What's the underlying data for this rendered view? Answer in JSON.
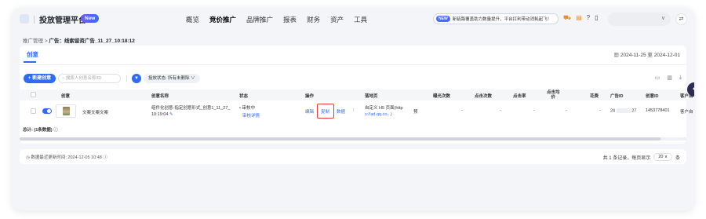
{
  "header": {
    "title": "投放管理平台",
    "new_badge": "New",
    "nav": [
      "概览",
      "竞价推广",
      "品牌推广",
      "报表",
      "财务",
      "资产",
      "工具"
    ],
    "active_nav_index": 1,
    "promo_tag": "NEW",
    "promo_text": "新链路覆盖助力数量提升，平台扛利带动消耗起飞！"
  },
  "breadcrumb": {
    "parent": "推广管理",
    "separator": ">",
    "current": "广告：线索留资广告_11_27_10:18:12"
  },
  "tab": {
    "label": "创意"
  },
  "date_range": "2024-11-25 至 2024-12-01",
  "toolbar": {
    "new_button": "+ 新建创意",
    "search_placeholder": "搜索人创意名称/ID",
    "filter_label": "投放状态: 所有未删除",
    "filter_chevron": "∨"
  },
  "table": {
    "headers": {
      "creative": "创意",
      "name": "创意名称",
      "status": "状态",
      "action": "操作",
      "landing": "落地页",
      "impressions": "曝光次数",
      "clicks": "点击次数",
      "ctr": "点击率",
      "cpc_line1": "点击均",
      "cpc_line2": "价",
      "cost": "花费",
      "ad_id": "广告ID",
      "creative_id": "创意ID",
      "client": "客户自"
    },
    "row": {
      "creative_text": "文案文案文案",
      "name_line1": "组件化创意-指定创意形式_创意1_11_27_",
      "name_line2": "10:19:04",
      "status_line1": "• 审核中",
      "status_line2": "审核详情",
      "op_edit": "编辑",
      "op_copy": "复制",
      "op_data": "数据",
      "op_more": "⋮",
      "landing_line1": "自定义 H5 页面(http",
      "landing_line2": "s://ad.qq.co...)",
      "landing_tag": "预",
      "impressions": "-",
      "clicks": "-",
      "ctr": "-",
      "cpc": "-",
      "cost": "-",
      "ad_id_prefix": "24",
      "ad_id_suffix": "27",
      "creative_id": "1453778401",
      "client": "客户自"
    },
    "total": "总计: (1条数据)"
  },
  "footer": {
    "updated": "数据最近更新时间: 2024-12-05 10:48",
    "summary": "共 1 条记录，每页显示",
    "page_size": "20 ∨",
    "unit": "条"
  },
  "colors": {
    "primary": "#2f6cf6",
    "highlight_box": "#e53935",
    "background": "#f3f5f9"
  }
}
